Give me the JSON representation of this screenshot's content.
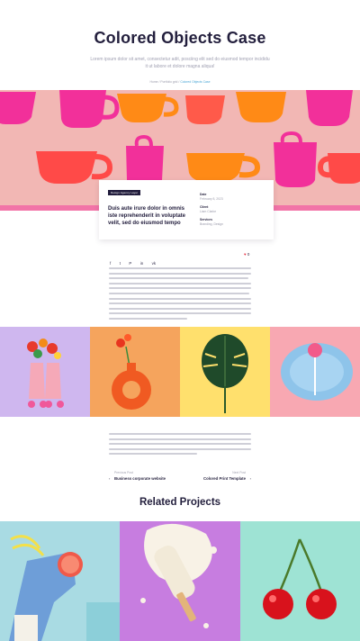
{
  "header": {
    "title": "Colored Objects Case",
    "subtitle": "Lorem ipsum dolor sit amet, consectetur adit, posciing elit sed do eiusmod tempor incididu it ut labore et dolore magna aliqua!",
    "breadcrumb": {
      "home": "Home",
      "sep1": "/",
      "section": "Portfolio grid",
      "sep2": "/",
      "current": "Colored Objects Case"
    }
  },
  "card": {
    "tag": "Design Agency Layer",
    "headline": "Duis aute irure dolor in omnis iste reprehenderit in voluptate velit, sed do eiusmod tempo",
    "meta": [
      {
        "label": "Date",
        "value": "February 8, 2023"
      },
      {
        "label": "Client",
        "value": "Liam Clarke"
      },
      {
        "label": "Services",
        "value": "Branding, Design"
      }
    ]
  },
  "share": {
    "icons": [
      "facebook-icon",
      "twitter-icon",
      "pinterest-icon",
      "linkedin-icon",
      "vk-icon"
    ],
    "glyphs": [
      "f",
      "t",
      "P",
      "in",
      "vk"
    ],
    "likes": "0"
  },
  "post_nav": {
    "prev_sub": "Previous Post",
    "prev_title": "Business corporate website",
    "next_sub": "Next Post",
    "next_title": "Colored Print Template"
  },
  "related": {
    "title": "Related Projects"
  },
  "colors": {
    "banner": "#f2b7b4",
    "accent": "#e5394a",
    "dark": "#231f3d",
    "link": "#4aa6d6"
  }
}
